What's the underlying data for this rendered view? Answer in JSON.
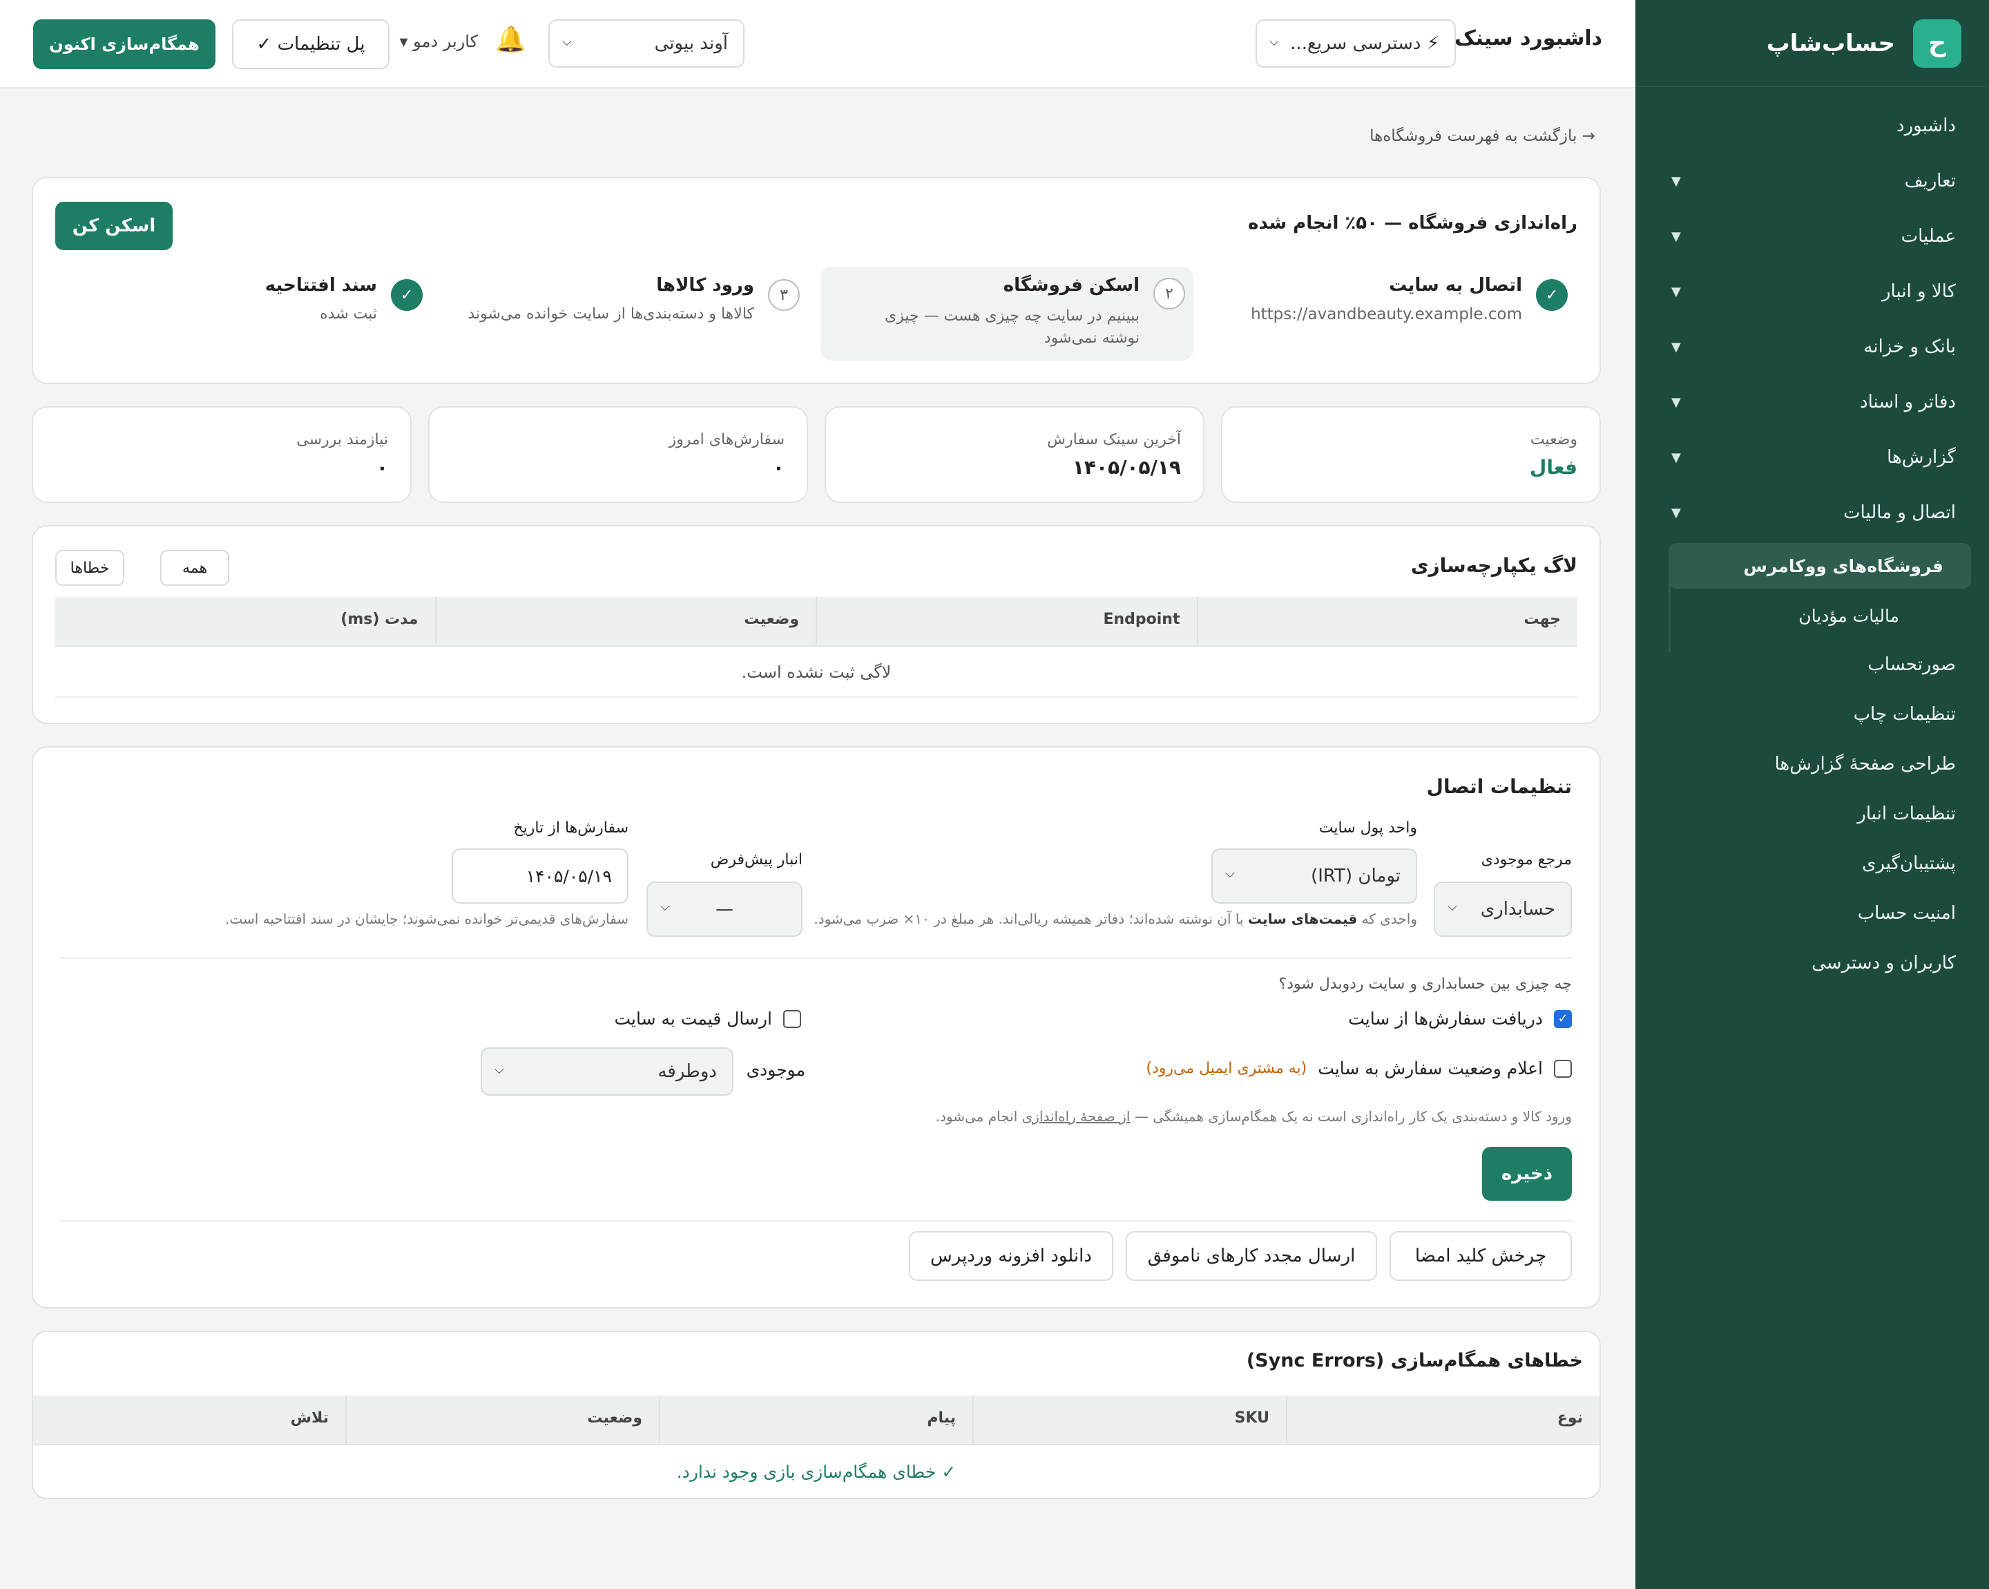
{
  "sidebar": {
    "logo_letter": "ح",
    "brand": "حساب‌شاپ",
    "items": [
      {
        "label": "داشبورد",
        "chevron": false
      },
      {
        "label": "تعاریف",
        "chevron": true
      },
      {
        "label": "عملیات",
        "chevron": true
      },
      {
        "label": "کالا و انبار",
        "chevron": true
      },
      {
        "label": "بانک و خزانه",
        "chevron": true
      },
      {
        "label": "دفاتر و اسناد",
        "chevron": true
      },
      {
        "label": "گزارش‌ها",
        "chevron": true
      },
      {
        "label": "اتصال و مالیات",
        "chevron": true
      }
    ],
    "sub_active": "فروشگاه‌های ووکامرس",
    "sub_items": [
      "مالیات مؤدیان"
    ],
    "bottom_items": [
      "صورتحساب",
      "تنظیمات چاپ",
      "طراحی صفحهٔ گزارش‌ها",
      "تنظیمات انبار",
      "پشتیبان‌گیری",
      "امنیت حساب",
      "کاربران و دسترسی"
    ]
  },
  "header": {
    "title": "داشبورد سینک",
    "quick_access": "⚡ دسترسی سریع...",
    "store_select": "آوند بیوتی",
    "bell_icon": "🔔",
    "user": "کاربر دمو ▾",
    "settings_button": "پل تنظیمات ✓",
    "sync_button": "همگام‌سازی اکنون"
  },
  "breadcrumb": "→ بازگشت به فهرست فروشگاه‌ها",
  "setup": {
    "title": "راه‌اندازی فروشگاه — ۵۰٪ انجام شده",
    "scan_button": "اسکن کن",
    "steps": [
      {
        "marker": "✓",
        "done": true,
        "title": "اتصال به سایت",
        "desc": "https://avandbeauty.example.com"
      },
      {
        "marker": "۲",
        "done": false,
        "title": "اسکن فروشگاه",
        "desc": "ببینیم در سایت چه چیزی هست — چیزی نوشته نمی‌شود"
      },
      {
        "marker": "۳",
        "done": false,
        "title": "ورود کالاها",
        "desc": "کالاها و دسته‌بندی‌ها از سایت خوانده می‌شوند"
      },
      {
        "marker": "✓",
        "done": true,
        "title": "سند افتتاحیه",
        "desc": "ثبت شده"
      }
    ]
  },
  "stats": [
    {
      "label": "وضعیت",
      "value": "فعال",
      "accent": true
    },
    {
      "label": "آخرین سینک سفارش",
      "value": "۱۴۰۵/۰۵/۱۹",
      "accent": false
    },
    {
      "label": "سفارش‌های امروز",
      "value": "۰",
      "accent": false
    },
    {
      "label": "نیازمند بررسی",
      "value": "۰",
      "accent": false
    }
  ],
  "log": {
    "title": "لاگ یکپارچه‌سازی",
    "filters": [
      "همه",
      "خطاها"
    ],
    "columns": [
      "جهت",
      "Endpoint",
      "وضعیت",
      "مدت (ms)"
    ],
    "empty": "لاگی ثبت نشده است."
  },
  "conn": {
    "title": "تنظیمات اتصال",
    "stock_ref_label": "مرجع موجودی",
    "stock_ref_value": "حسابداری",
    "currency_label": "واحد پول سایت",
    "currency_value": "تومان (IRT)",
    "currency_help_1": "واحدی که",
    "currency_help_bold": "قیمت‌های سایت",
    "currency_help_2": "با آن نوشته شده‌اند؛ دفاتر همیشه ریالی‌اند. هر مبلغ در ۱۰× ضرب می‌شود.",
    "warehouse_label": "انبار پیش‌فرض",
    "warehouse_value": "—",
    "from_date_label": "سفارش‌ها از تاریخ",
    "from_date_value": "۱۴۰۵/۰۵/۱۹",
    "from_date_help": "سفارش‌های قدیمی‌تر خوانده نمی‌شوند؛ جایشان در سند افتتاحیه است.",
    "exchange_q": "چه چیزی بین حسابداری و سایت ردوبدل شود؟",
    "opt_receive_orders": "دریافت سفارش‌ها از سایت",
    "opt_send_price": "ارسال قیمت به سایت",
    "opt_status": "اعلام وضعیت سفارش به سایت",
    "opt_status_note": "(به مشتری ایمیل می‌رود)",
    "stock_label": "موجودی",
    "stock_value": "دوطرفه",
    "import_note_1": "ورود کالا و دسته‌بندی یک کار راه‌اندازی است نه یک همگام‌سازی همیشگی —",
    "import_note_link": "از صفحهٔ راه‌اندازی",
    "import_note_2": "انجام می‌شود.",
    "save": "ذخیره",
    "btn_rotate": "چرخش کلید امضا",
    "btn_resend": "ارسال مجدد کارهای ناموفق",
    "btn_plugin": "دانلود افزونه وردپرس"
  },
  "errors": {
    "title": "خطاهای همگام‌سازی (Sync Errors)",
    "columns": [
      "نوع",
      "SKU",
      "پیام",
      "وضعیت",
      "تلاش"
    ],
    "empty": "✓ خطای همگام‌سازی بازی وجود ندارد."
  },
  "colors": {
    "sidebar": "#1c4a3f",
    "accent": "#1d7d65",
    "status_active": "#1d7d65",
    "note_orange": "#c0630a"
  }
}
